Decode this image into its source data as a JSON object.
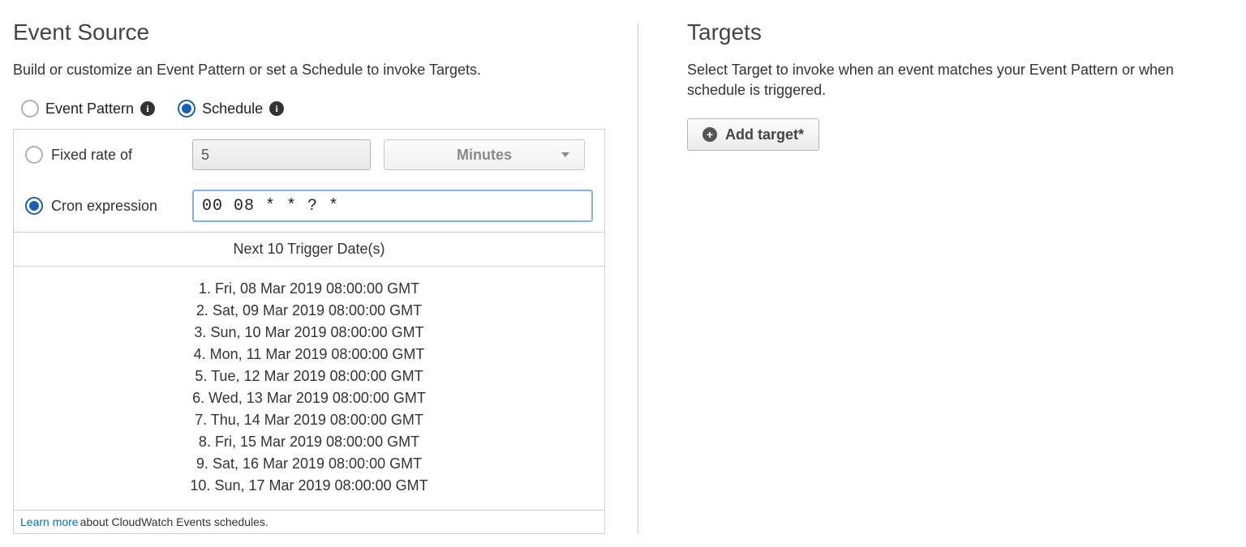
{
  "eventSource": {
    "title": "Event Source",
    "desc": "Build or customize an Event Pattern or set a Schedule to invoke Targets.",
    "options": {
      "eventPattern": "Event Pattern",
      "schedule": "Schedule"
    },
    "fixedRate": {
      "label": "Fixed rate of",
      "value": "5",
      "unit": "Minutes"
    },
    "cron": {
      "label": "Cron expression",
      "value": "00 08 * * ? *"
    },
    "nextTriggers": {
      "heading": "Next 10 Trigger Date(s)",
      "items": [
        "Fri, 08 Mar 2019 08:00:00 GMT",
        "Sat, 09 Mar 2019 08:00:00 GMT",
        "Sun, 10 Mar 2019 08:00:00 GMT",
        "Mon, 11 Mar 2019 08:00:00 GMT",
        "Tue, 12 Mar 2019 08:00:00 GMT",
        "Wed, 13 Mar 2019 08:00:00 GMT",
        "Thu, 14 Mar 2019 08:00:00 GMT",
        "Fri, 15 Mar 2019 08:00:00 GMT",
        "Sat, 16 Mar 2019 08:00:00 GMT",
        "Sun, 17 Mar 2019 08:00:00 GMT"
      ]
    },
    "footer": {
      "link": "Learn more",
      "text": "about CloudWatch Events schedules."
    }
  },
  "targets": {
    "title": "Targets",
    "desc": "Select Target to invoke when an event matches your Event Pattern or when schedule is triggered.",
    "addButton": "Add target*"
  }
}
